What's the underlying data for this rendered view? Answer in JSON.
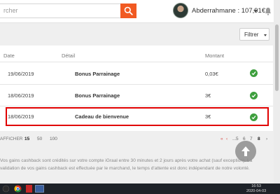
{
  "header": {
    "search_placeholder": "rcher",
    "user_label": "Abderrahmane : 107,91€"
  },
  "filter_label": "Filtrer",
  "table": {
    "columns": [
      "Date",
      "Détail",
      "Montant"
    ],
    "rows": [
      {
        "date": "19/06/2019",
        "detail": "Bonus Parrainage",
        "amount": "0,03€",
        "status": "validated"
      },
      {
        "date": "18/06/2019",
        "detail": "Bonus Parrainage",
        "amount": "3€",
        "status": "validated"
      },
      {
        "date": "18/06/2019",
        "detail": "Cadeau de bienvenue",
        "amount": "3€",
        "status": "validated"
      }
    ]
  },
  "pagination": {
    "show_label": "AFFICHER",
    "page_sizes": [
      "15",
      "50",
      "100"
    ],
    "selected_page_size": "15",
    "prev_arrow": "‹",
    "first_arrow": "«",
    "ellipsis": "...",
    "pages": [
      "5",
      "6",
      "7",
      "8"
    ],
    "current_page": "8",
    "next_arrow": "›"
  },
  "footnote": "Vos gains cashback sont crédités sur votre compte iGraal entre 30 minutes et 2 jours après votre achat (sauf exception). La validation de vos gains cashback est effectuée par le marchand, le temps d'attente est donc indépendant de notre volonté.",
  "taskbar": {
    "time": "16:53",
    "date": "2020-04-03"
  },
  "colors": {
    "accent": "#f15a22",
    "check": "#3e9f3e",
    "highlight": "#e00000"
  }
}
